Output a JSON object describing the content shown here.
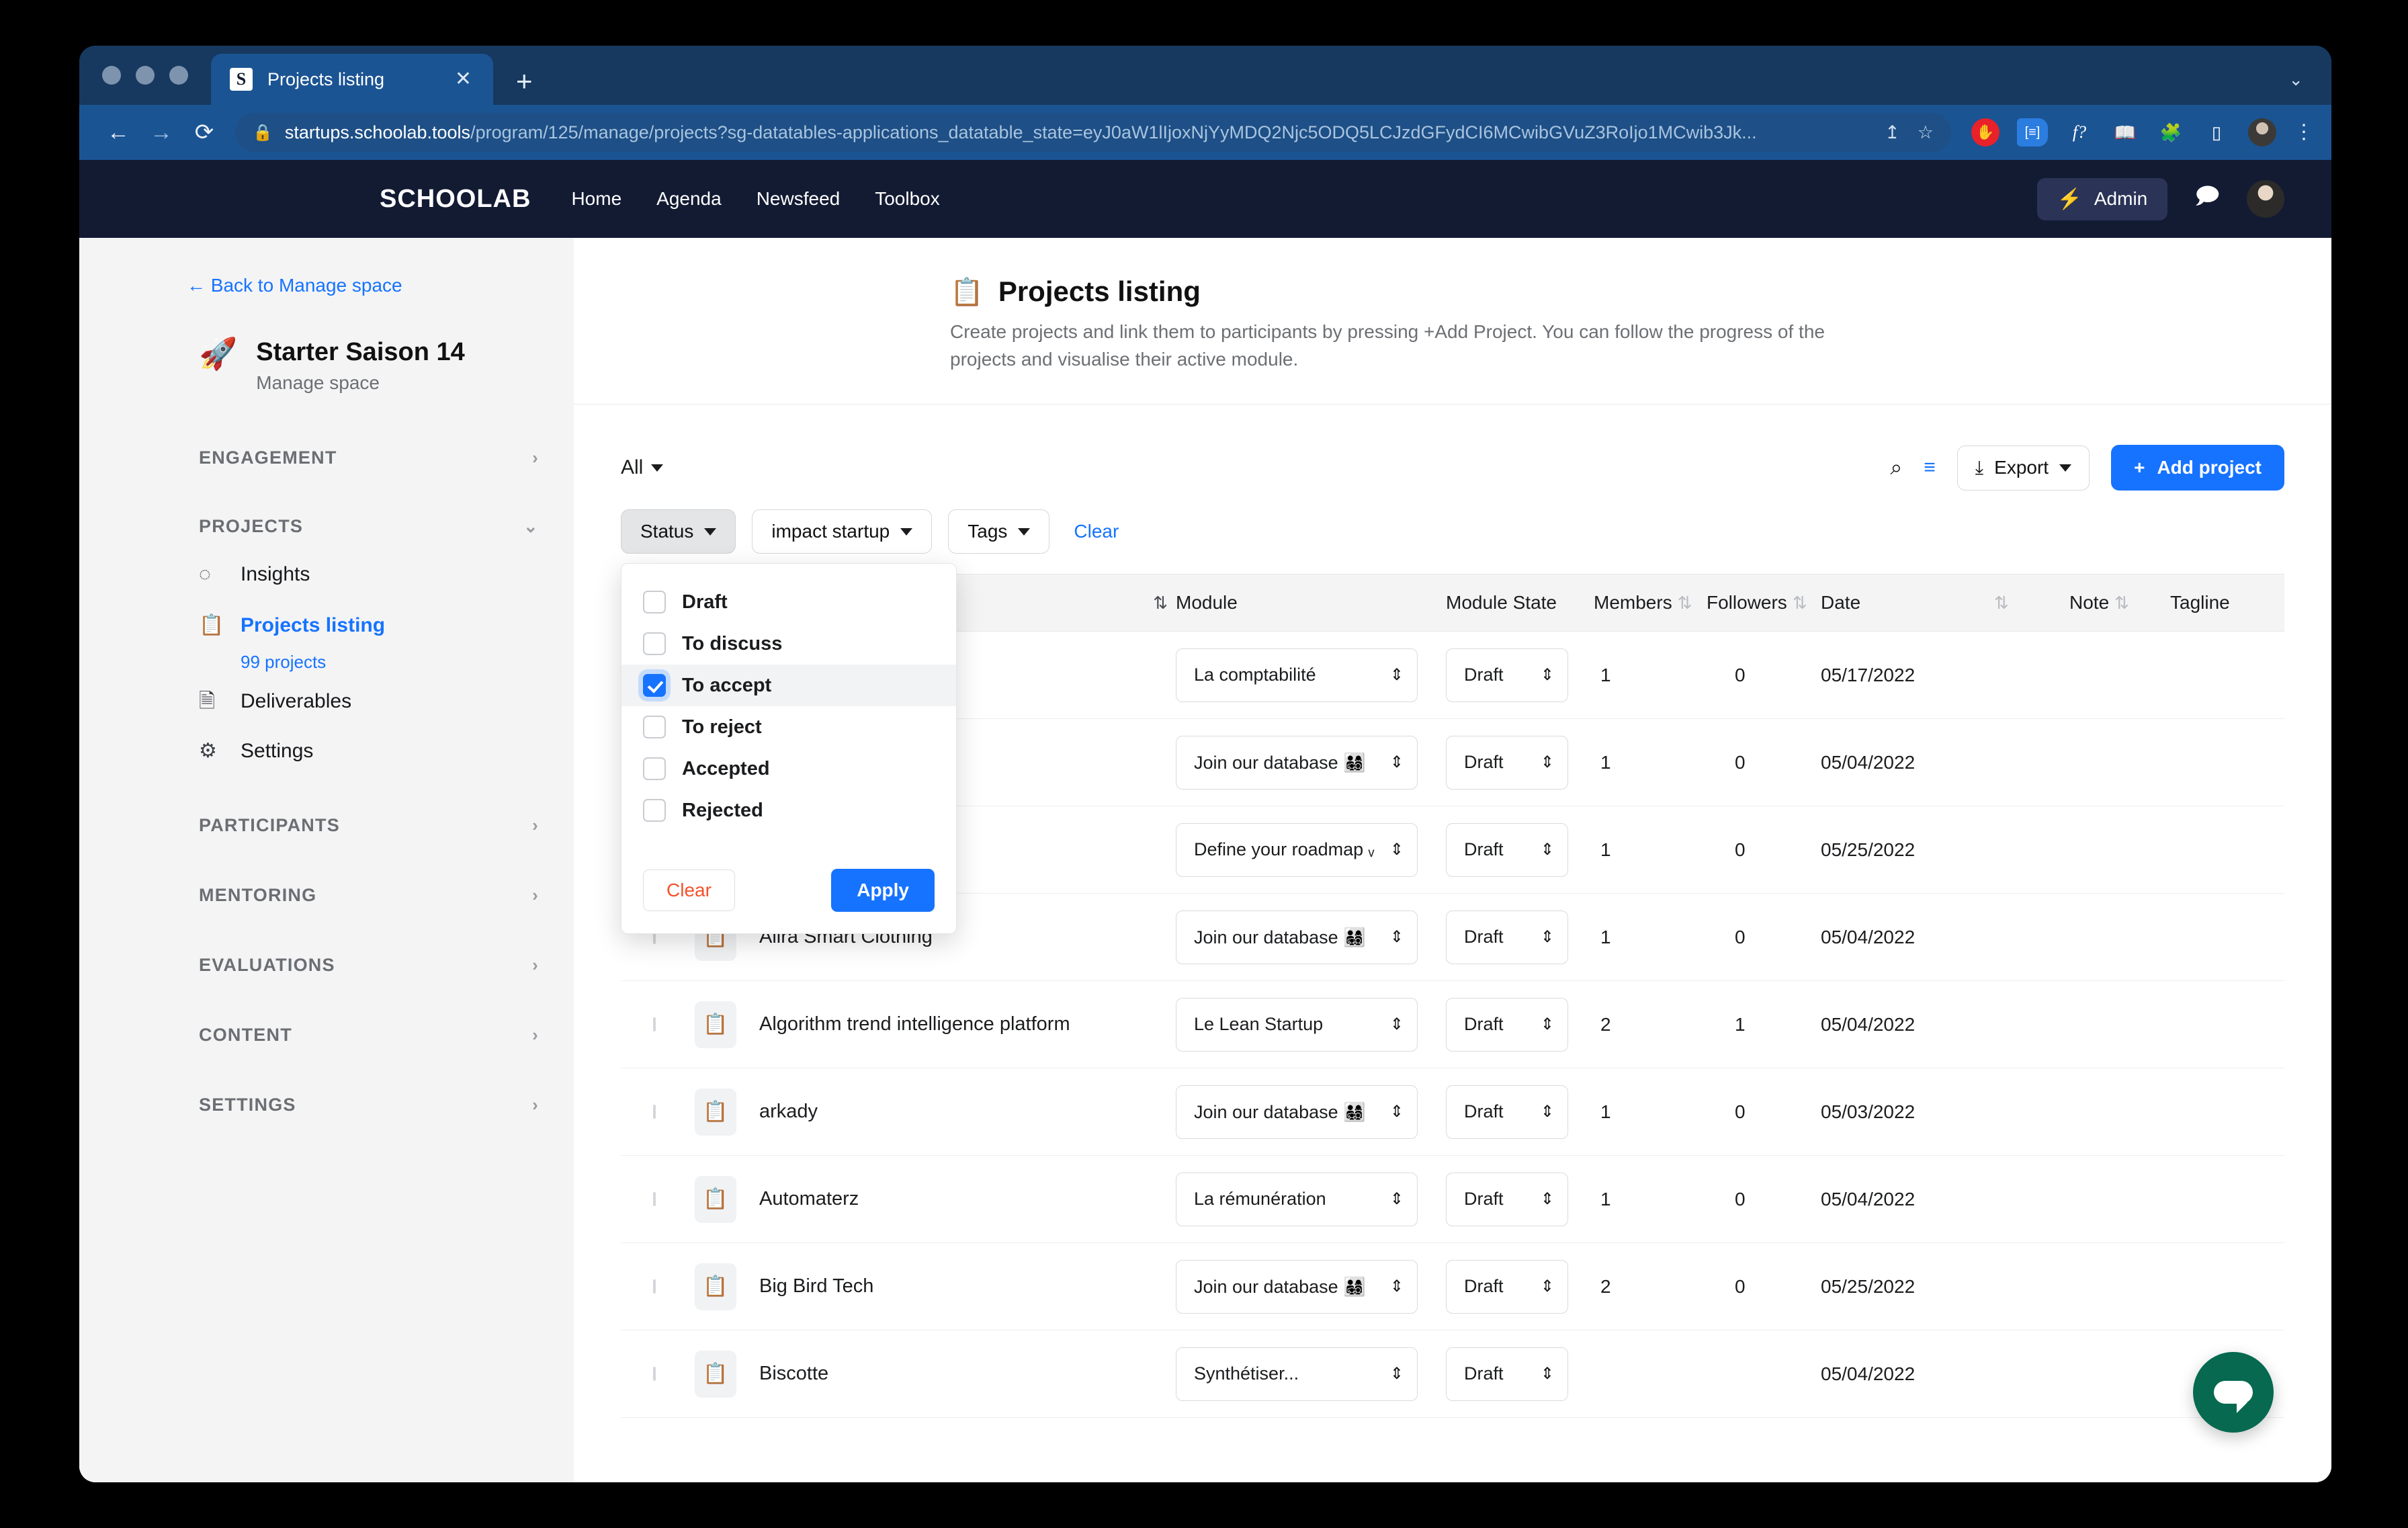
{
  "browser": {
    "tab_title": "Projects listing",
    "favicon_letter": "S",
    "close_label": "✕",
    "new_tab_label": "+",
    "tabstrip_chevron": "⌄",
    "back_label": "←",
    "forward_label": "→",
    "reload_label": "⟳",
    "lock_icon": "🔒",
    "url_strong": "startups.schoolab.tools",
    "url_dim": "/program/125/manage/projects?sg-datatables-applications_datatable_state=eyJ0aW1lIjoxNjYyMDQ2Njc5ODQ5LCJzdGFydCI6MCwibGVuZ3RoIjo1MCwib3Jk...",
    "share_icon": "↥",
    "star_icon": "☆",
    "ext_stop": "✋",
    "ext_tag": "[≡]",
    "ext_fq": "f?",
    "ext_book": "📖",
    "ext_puzzle": "🧩",
    "ext_panel": "▯",
    "kebab": "⋮"
  },
  "navbar": {
    "brand": "SCHOOLAB",
    "links": [
      "Home",
      "Agenda",
      "Newsfeed",
      "Toolbox"
    ],
    "admin_label": "Admin",
    "bolt_icon": "⚡",
    "chat_icon": "🗩"
  },
  "sidebar": {
    "back_label": "← Back to Manage space",
    "space_emoji": "🚀",
    "space_name": "Starter Saison 14",
    "space_sub": "Manage space",
    "sections": [
      {
        "label": "ENGAGEMENT",
        "chevron": "›"
      },
      {
        "label": "PROJECTS",
        "chevron": "⌄"
      },
      {
        "label": "PARTICIPANTS",
        "chevron": "›"
      },
      {
        "label": "MENTORING",
        "chevron": "›"
      },
      {
        "label": "EVALUATIONS",
        "chevron": "›"
      },
      {
        "label": "CONTENT",
        "chevron": "›"
      },
      {
        "label": "SETTINGS",
        "chevron": "›"
      }
    ],
    "projects_items": [
      {
        "label": "Insights",
        "icon": "◌"
      },
      {
        "label": "Projects listing",
        "icon": "📋",
        "sub": "99 projects",
        "active": true
      },
      {
        "label": "Deliverables",
        "icon": "🗎"
      },
      {
        "label": "Settings",
        "icon": "⚙"
      }
    ]
  },
  "page_header": {
    "icon": "📋",
    "title": "Projects listing",
    "description": "Create projects and link them to participants by pressing +Add Project. You can follow the progress of the projects and visualise their active module."
  },
  "toolbar": {
    "all_label": "All",
    "search_icon": "⌕",
    "filter_icon": "≡",
    "export_label": "Export",
    "export_icon": "⤓",
    "add_label": "Add project",
    "add_icon": "+"
  },
  "filters": {
    "status_label": "Status",
    "impact_label": "impact startup",
    "tags_label": "Tags",
    "clear_label": "Clear"
  },
  "status_dropdown": {
    "options": [
      {
        "label": "Draft",
        "checked": false
      },
      {
        "label": "To discuss",
        "checked": false
      },
      {
        "label": "To accept",
        "checked": true
      },
      {
        "label": "To reject",
        "checked": false
      },
      {
        "label": "Accepted",
        "checked": false
      },
      {
        "label": "Rejected",
        "checked": false
      }
    ],
    "clear_label": "Clear",
    "apply_label": "Apply"
  },
  "table": {
    "headers": {
      "name_sort": "⇅",
      "module": "Module",
      "module_state": "Module State",
      "members": "Members",
      "members_sort": "⇅",
      "followers": "Followers",
      "followers_sort": "⇅",
      "date": "Date",
      "date_sort": "⇅",
      "note": "Note",
      "note_sort": "⇅",
      "tagline": "Tagline"
    },
    "rows": [
      {
        "name": "",
        "module": "La comptabilité",
        "state": "Draft",
        "members": "1",
        "followers": "0",
        "date": "05/17/2022"
      },
      {
        "name": "",
        "module": "Join our database 👨‍👩‍👧‍👦",
        "state": "Draft",
        "members": "1",
        "followers": "0",
        "date": "05/04/2022"
      },
      {
        "name": "",
        "module": "Define your roadmap ᵥ",
        "state": "Draft",
        "members": "1",
        "followers": "0",
        "date": "05/25/2022"
      },
      {
        "name": "Alira Smart Clothing",
        "module": "Join our database 👨‍👩‍👧‍👦",
        "state": "Draft",
        "members": "1",
        "followers": "0",
        "date": "05/04/2022"
      },
      {
        "name": "Algorithm trend intelligence platform",
        "module": "Le Lean Startup",
        "state": "Draft",
        "members": "2",
        "followers": "1",
        "date": "05/04/2022"
      },
      {
        "name": "arkady",
        "module": "Join our database 👨‍👩‍👧‍👦",
        "state": "Draft",
        "members": "1",
        "followers": "0",
        "date": "05/03/2022"
      },
      {
        "name": "Automaterz",
        "module": "La rémunération",
        "state": "Draft",
        "members": "1",
        "followers": "0",
        "date": "05/04/2022"
      },
      {
        "name": "Big Bird Tech",
        "module": "Join our database 👨‍👩‍👧‍👦",
        "state": "Draft",
        "members": "2",
        "followers": "0",
        "date": "05/25/2022"
      },
      {
        "name": "Biscotte",
        "module": "Synthétiser...",
        "state": "Draft",
        "members": "",
        "followers": "",
        "date": "05/04/2022"
      }
    ],
    "row_icon": "📋",
    "select_spinner": "⇕"
  },
  "chat_fab": {
    "icon": "chat-bubble"
  },
  "colors": {
    "accent": "#1673ff",
    "navbar": "#131b33",
    "chat": "#066950",
    "danger": "#f4512c"
  }
}
